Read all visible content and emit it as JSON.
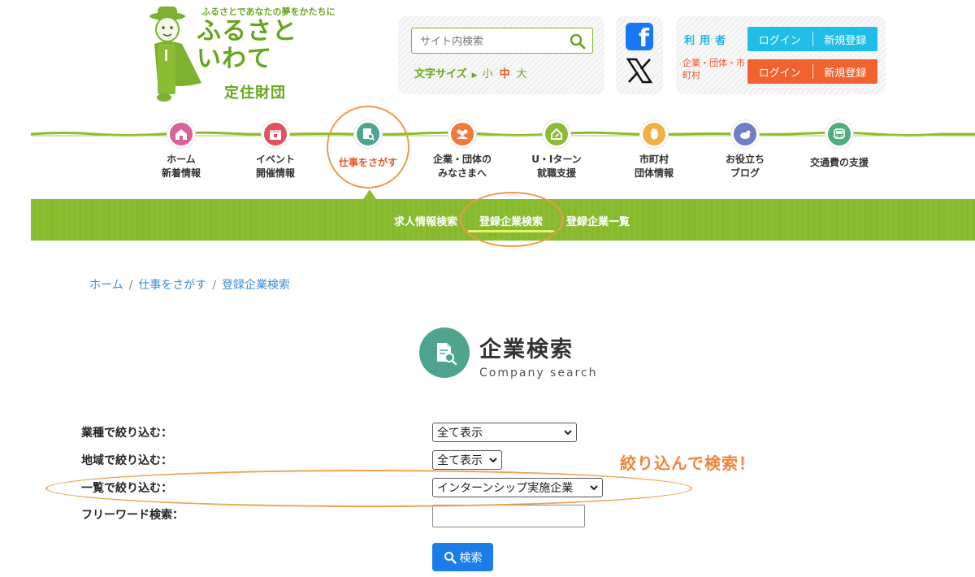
{
  "logo": {
    "tagline": "ふるさとであなたの夢をかたちに",
    "name_line1": "ふるさと",
    "name_line2": "いわて",
    "subtitle": "定住財団"
  },
  "search": {
    "placeholder": "サイト内検索",
    "fontsize_label": "文字サイズ",
    "fontsize_options": [
      "小",
      "中",
      "大"
    ],
    "fontsize_active": "中"
  },
  "social": {
    "facebook_glyph": "f"
  },
  "login": {
    "user_label": "利用者",
    "corp_label": "企業・団体・市町村",
    "user_login": "ログイン",
    "user_register": "新規登録",
    "corp_login": "ログイン",
    "corp_register": "新規登録"
  },
  "nav": {
    "items": [
      {
        "label": "ホーム\n新着情報",
        "icon": "home-icon",
        "color": "#d9629b"
      },
      {
        "label": "イベント\n開催情報",
        "icon": "calendar-icon",
        "color": "#e05260"
      },
      {
        "label": "仕事をさがす",
        "icon": "document-search-icon",
        "color": "#4ea58e",
        "active": true
      },
      {
        "label": "企業・団体の\nみなさまへ",
        "icon": "people-icon",
        "color": "#f07a37"
      },
      {
        "label": "U・Iターン\n就職支援",
        "icon": "house-leaf-icon",
        "color": "#8cbb34"
      },
      {
        "label": "市町村\n団体情報",
        "icon": "iwate-map-icon",
        "color": "#f0b045"
      },
      {
        "label": "お役立ち\nブログ",
        "icon": "bird-icon",
        "color": "#6f7fc4"
      },
      {
        "label": "交通費の支援",
        "icon": "train-icon",
        "color": "#4fae7c"
      }
    ],
    "active_color": "#e8562a"
  },
  "subnav": {
    "items": [
      "求人情報検索",
      "登録企業検索",
      "登録企業一覧"
    ],
    "active": "登録企業検索",
    "bg_color": "#8bbd32"
  },
  "breadcrumb": [
    "ホーム",
    "仕事をさがす",
    "登録企業検索"
  ],
  "page_title": {
    "jp": "企業検索",
    "en": "Company search"
  },
  "form": {
    "industry_label": "業種で絞り込む：",
    "industry_value": "全て表示",
    "region_label": "地域で絞り込む：",
    "region_value": "全て表示",
    "list_label": "一覧で絞り込む：",
    "list_value": "インターンシップ実施企業",
    "freeword_label": "フリーワード検索：",
    "freeword_value": "",
    "search_button": "検索"
  },
  "annotation": "絞り込んで検索！",
  "colors": {
    "brand_green": "#6aa51f",
    "accent_orange": "#f0984b",
    "login_blue": "#1fbde8",
    "login_orange": "#f2622e",
    "button_blue": "#1a7de8"
  }
}
